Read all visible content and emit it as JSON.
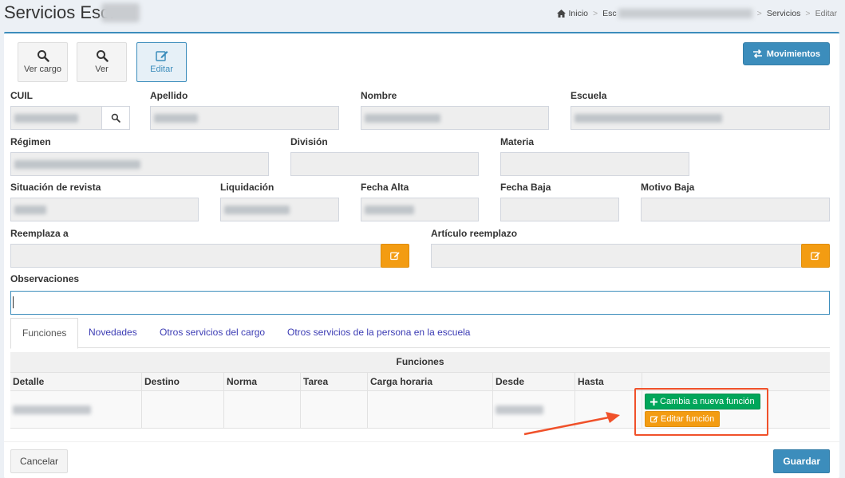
{
  "header": {
    "title": "Servicios Esc.",
    "breadcrumb": {
      "home": "Inicio",
      "school_prefix": "Esc",
      "section": "Servicios",
      "current": "Editar"
    }
  },
  "toolbar": {
    "ver_cargo": "Ver cargo",
    "ver": "Ver",
    "editar": "Editar",
    "movimientos": "Movimientos"
  },
  "form": {
    "cuil": "CUIL",
    "apellido": "Apellido",
    "nombre": "Nombre",
    "escuela": "Escuela",
    "regimen": "Régimen",
    "division": "División",
    "materia": "Materia",
    "situacion_revista": "Situación de revista",
    "liquidacion": "Liquidación",
    "fecha_alta": "Fecha Alta",
    "fecha_baja": "Fecha Baja",
    "motivo_baja": "Motivo Baja",
    "reemplaza_a": "Reemplaza a",
    "articulo_reemplazo": "Artículo reemplazo",
    "observaciones": "Observaciones"
  },
  "tabs": [
    "Funciones",
    "Novedades",
    "Otros servicios del cargo",
    "Otros servicios de la persona en la escuela"
  ],
  "table": {
    "caption": "Funciones",
    "headers": [
      "Detalle",
      "Destino",
      "Norma",
      "Tarea",
      "Carga horaria",
      "Desde",
      "Hasta"
    ]
  },
  "actions": {
    "cambia_funcion": "Cambia a nueva función",
    "editar_funcion": "Editar función"
  },
  "footer": {
    "cancelar": "Cancelar",
    "guardar": "Guardar"
  },
  "colors": {
    "primary": "#3c8dbc",
    "success": "#00a65a",
    "warning": "#f39c12",
    "annotation": "#f0512a"
  }
}
